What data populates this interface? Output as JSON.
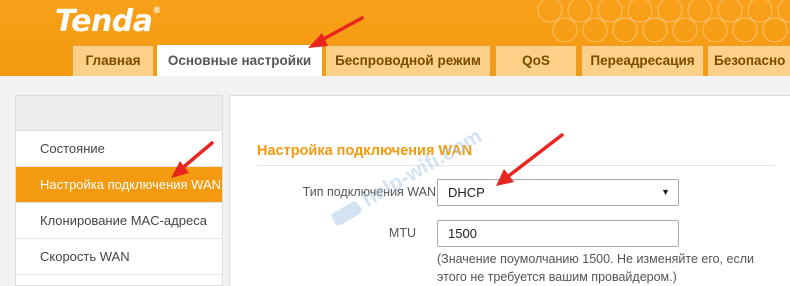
{
  "logo": {
    "text": "Tenda",
    "mark": "®"
  },
  "tabs": [
    {
      "label": "Главная",
      "active": false
    },
    {
      "label": "Основные настройки",
      "active": true
    },
    {
      "label": "Беспроводной режим",
      "active": false
    },
    {
      "label": "QoS",
      "active": false
    },
    {
      "label": "Переадресация",
      "active": false
    },
    {
      "label": "Безопасно",
      "active": false
    }
  ],
  "sidebar": {
    "items": [
      {
        "label": "Состояние",
        "active": false
      },
      {
        "label": "Настройка подключения WAN",
        "active": true
      },
      {
        "label": "Клонирование MAC-адреса",
        "active": false
      },
      {
        "label": "Скорость WAN",
        "active": false
      }
    ]
  },
  "main": {
    "section_title": "Настройка подключения WAN",
    "wan_type_label": "Тип подключения WAN",
    "wan_type_value": "DHCP",
    "mtu_label": "MTU",
    "mtu_value": "1500",
    "mtu_hint": "(Значение поумолчанию 1500. Не изменяйте его, если этого не требуется вашим провайдером.)"
  },
  "watermark": {
    "text": "help-wifi.com"
  },
  "colors": {
    "accent": "#f39a10",
    "arrow": "#e8261f",
    "tab_bg": "#fcd088"
  }
}
